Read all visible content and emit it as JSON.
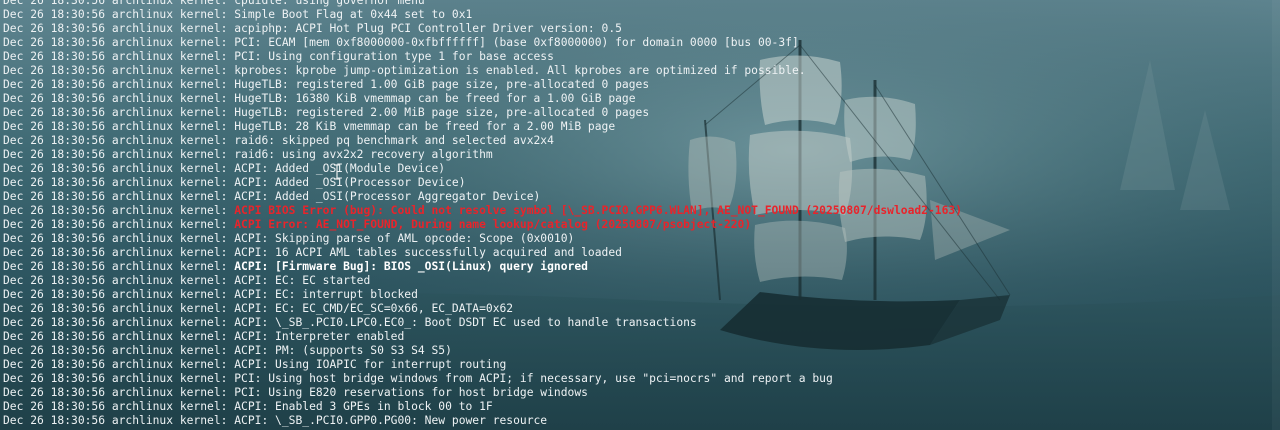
{
  "terminal": {
    "background_image": "pirate-ship-wallpaper",
    "error_color": "#e8242b",
    "text_color": "#eef2f4",
    "lines": [
      {
        "prefix": "Dec 26 18:30:56 archlinux kernel: ",
        "message": "cpuidle: using governor menu",
        "style": "normal"
      },
      {
        "prefix": "Dec 26 18:30:56 archlinux kernel: ",
        "message": "Simple Boot Flag at 0x44 set to 0x1",
        "style": "normal"
      },
      {
        "prefix": "Dec 26 18:30:56 archlinux kernel: ",
        "message": "acpiphp: ACPI Hot Plug PCI Controller Driver version: 0.5",
        "style": "normal"
      },
      {
        "prefix": "Dec 26 18:30:56 archlinux kernel: ",
        "message": "PCI: ECAM [mem 0xf8000000-0xfbffffff] (base 0xf8000000) for domain 0000 [bus 00-3f]",
        "style": "normal"
      },
      {
        "prefix": "Dec 26 18:30:56 archlinux kernel: ",
        "message": "PCI: Using configuration type 1 for base access",
        "style": "normal"
      },
      {
        "prefix": "Dec 26 18:30:56 archlinux kernel: ",
        "message": "kprobes: kprobe jump-optimization is enabled. All kprobes are optimized if possible.",
        "style": "normal"
      },
      {
        "prefix": "Dec 26 18:30:56 archlinux kernel: ",
        "message": "HugeTLB: registered 1.00 GiB page size, pre-allocated 0 pages",
        "style": "normal"
      },
      {
        "prefix": "Dec 26 18:30:56 archlinux kernel: ",
        "message": "HugeTLB: 16380 KiB vmemmap can be freed for a 1.00 GiB page",
        "style": "normal"
      },
      {
        "prefix": "Dec 26 18:30:56 archlinux kernel: ",
        "message": "HugeTLB: registered 2.00 MiB page size, pre-allocated 0 pages",
        "style": "normal"
      },
      {
        "prefix": "Dec 26 18:30:56 archlinux kernel: ",
        "message": "HugeTLB: 28 KiB vmemmap can be freed for a 2.00 MiB page",
        "style": "normal"
      },
      {
        "prefix": "Dec 26 18:30:56 archlinux kernel: ",
        "message": "raid6: skipped pq benchmark and selected avx2x4",
        "style": "normal"
      },
      {
        "prefix": "Dec 26 18:30:56 archlinux kernel: ",
        "message": "raid6: using avx2x2 recovery algorithm",
        "style": "normal"
      },
      {
        "prefix": "Dec 26 18:30:56 archlinux kernel: ",
        "message": "ACPI: Added _OSI(Module Device)",
        "style": "normal"
      },
      {
        "prefix": "Dec 26 18:30:56 archlinux kernel: ",
        "message": "ACPI: Added _OSI(Processor Device)",
        "style": "normal"
      },
      {
        "prefix": "Dec 26 18:30:56 archlinux kernel: ",
        "message": "ACPI: Added _OSI(Processor Aggregator Device)",
        "style": "normal"
      },
      {
        "prefix": "Dec 26 18:30:56 archlinux kernel: ",
        "message": "ACPI BIOS Error (bug): Could not resolve symbol [\\_SB.PCI0.GPP6.WLAN], AE_NOT_FOUND (20250807/dswload2-163)",
        "style": "error"
      },
      {
        "prefix": "Dec 26 18:30:56 archlinux kernel: ",
        "message": "ACPI Error: AE_NOT_FOUND, During name lookup/catalog (20250807/psobject-220)",
        "style": "error"
      },
      {
        "prefix": "Dec 26 18:30:56 archlinux kernel: ",
        "message": "ACPI: Skipping parse of AML opcode: Scope (0x0010)",
        "style": "normal"
      },
      {
        "prefix": "Dec 26 18:30:56 archlinux kernel: ",
        "message": "ACPI: 16 ACPI AML tables successfully acquired and loaded",
        "style": "normal"
      },
      {
        "prefix": "Dec 26 18:30:56 archlinux kernel: ",
        "message": "ACPI: [Firmware Bug]: BIOS _OSI(Linux) query ignored",
        "style": "bold"
      },
      {
        "prefix": "Dec 26 18:30:56 archlinux kernel: ",
        "message": "ACPI: EC: EC started",
        "style": "normal"
      },
      {
        "prefix": "Dec 26 18:30:56 archlinux kernel: ",
        "message": "ACPI: EC: interrupt blocked",
        "style": "normal"
      },
      {
        "prefix": "Dec 26 18:30:56 archlinux kernel: ",
        "message": "ACPI: EC: EC_CMD/EC_SC=0x66, EC_DATA=0x62",
        "style": "normal"
      },
      {
        "prefix": "Dec 26 18:30:56 archlinux kernel: ",
        "message": "ACPI: \\_SB_.PCI0.LPC0.EC0_: Boot DSDT EC used to handle transactions",
        "style": "normal"
      },
      {
        "prefix": "Dec 26 18:30:56 archlinux kernel: ",
        "message": "ACPI: Interpreter enabled",
        "style": "normal"
      },
      {
        "prefix": "Dec 26 18:30:56 archlinux kernel: ",
        "message": "ACPI: PM: (supports S0 S3 S4 S5)",
        "style": "normal"
      },
      {
        "prefix": "Dec 26 18:30:56 archlinux kernel: ",
        "message": "ACPI: Using IOAPIC for interrupt routing",
        "style": "normal"
      },
      {
        "prefix": "Dec 26 18:30:56 archlinux kernel: ",
        "message": "PCI: Using host bridge windows from ACPI; if necessary, use \"pci=nocrs\" and report a bug",
        "style": "normal"
      },
      {
        "prefix": "Dec 26 18:30:56 archlinux kernel: ",
        "message": "PCI: Using E820 reservations for host bridge windows",
        "style": "normal"
      },
      {
        "prefix": "Dec 26 18:30:56 archlinux kernel: ",
        "message": "ACPI: Enabled 3 GPEs in block 00 to 1F",
        "style": "normal"
      },
      {
        "prefix": "Dec 26 18:30:56 archlinux kernel: ",
        "message": "ACPI: \\_SB_.PCI0.GPP0.PG00: New power resource",
        "style": "normal"
      }
    ]
  }
}
